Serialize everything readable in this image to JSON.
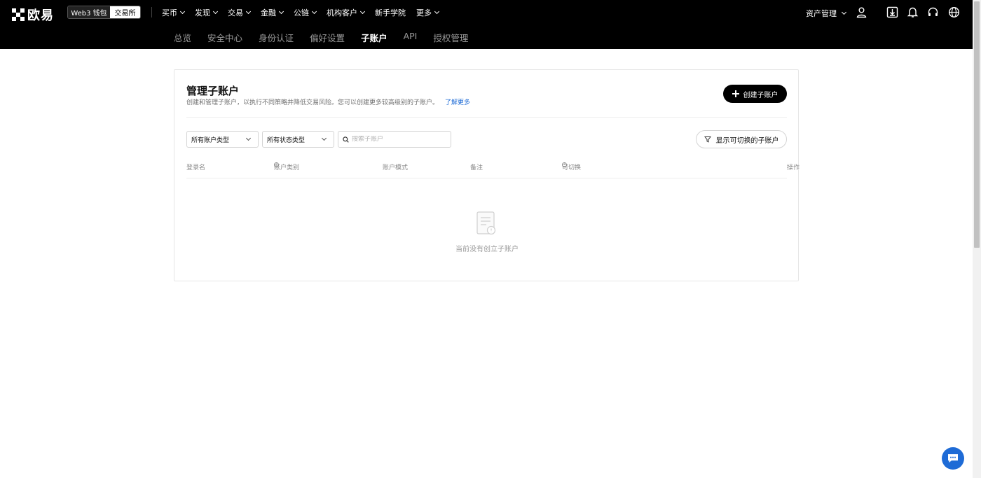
{
  "header": {
    "logo_text": "欧易",
    "switch": {
      "wallet": "Web3 钱包",
      "exchange": "交易所"
    },
    "nav": [
      {
        "label": "买币",
        "dropdown": true
      },
      {
        "label": "发现",
        "dropdown": true
      },
      {
        "label": "交易",
        "dropdown": true
      },
      {
        "label": "金融",
        "dropdown": true
      },
      {
        "label": "公链",
        "dropdown": true
      },
      {
        "label": "机构客户",
        "dropdown": true
      },
      {
        "label": "新手学院",
        "dropdown": false
      },
      {
        "label": "更多",
        "dropdown": true
      }
    ],
    "asset_label": "资产管理",
    "icons": [
      "user-icon",
      "download-icon",
      "bell-icon",
      "headset-icon",
      "globe-icon"
    ]
  },
  "subnav": {
    "tabs": [
      "总览",
      "安全中心",
      "身份认证",
      "偏好设置",
      "子账户",
      "API",
      "授权管理"
    ],
    "active": "子账户"
  },
  "card": {
    "title": "管理子账户",
    "description": "创建和管理子账户，以执行不同策略并降低交易风险。您可以创建更多较高级别的子账户。",
    "learn_more": "了解更多",
    "create_button": "创建子账户"
  },
  "filters": {
    "account_type": "所有账户类型",
    "status_type": "所有状态类型",
    "search_placeholder": "搜索子账户",
    "switchable_button": "显示可切换的子账户"
  },
  "table": {
    "columns": [
      "登录名",
      "账户类别",
      "账户模式",
      "备注",
      "可切换",
      "操作"
    ],
    "rows": [],
    "empty_text": "当前没有创立子账户"
  },
  "colors": {
    "header_bg": "#000000",
    "accent": "#1e6bd6",
    "primary_button": "#000000"
  }
}
